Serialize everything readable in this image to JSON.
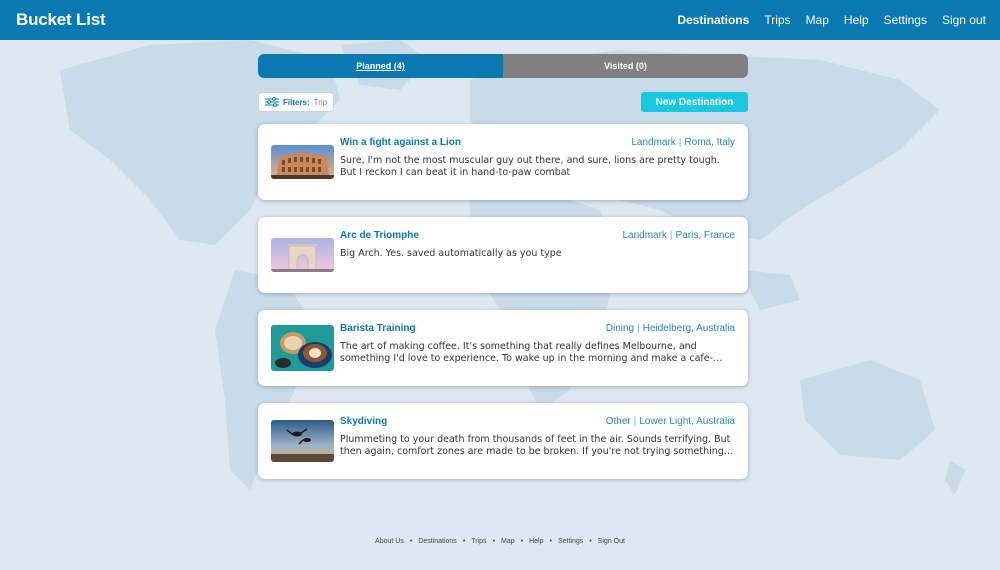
{
  "app": {
    "title": "Bucket List"
  },
  "nav": {
    "items": [
      {
        "label": "Destinations",
        "active": true
      },
      {
        "label": "Trips"
      },
      {
        "label": "Map"
      },
      {
        "label": "Help"
      },
      {
        "label": "Settings"
      },
      {
        "label": "Sign out"
      }
    ]
  },
  "tabs": [
    {
      "label": "Planned (4)",
      "active": true
    },
    {
      "label": "Visited (0)",
      "active": false
    }
  ],
  "toolbar": {
    "filters_label": "Filters:",
    "filters_value": "Trip",
    "new_destination_label": "New Destination"
  },
  "destinations": [
    {
      "title": "Win a fight against a Lion",
      "category": "Landmark",
      "location": "Roma, Italy",
      "description": "Sure, I'm not the most muscular guy out there, and sure, lions are pretty tough. But I reckon I can beat it in hand-to-paw combat",
      "thumbnail": "colosseum-photo"
    },
    {
      "title": "Arc de Triomphe",
      "category": "Landmark",
      "location": "Paris, France",
      "description": "Big Arch. Yes. saved automatically as you type",
      "thumbnail": "arc-de-triomphe-photo"
    },
    {
      "title": "Barista Training",
      "category": "Dining",
      "location": "Heidelberg, Australia",
      "description": "The art of making coffee. It's something that really defines Melbourne, and something I'd love to experience. To wake up in the morning and make a cafe-…",
      "thumbnail": "coffee-photo"
    },
    {
      "title": "Skydiving",
      "category": "Other",
      "location": "Lower Light, Australia",
      "description": "Plummeting to your death from thousands of feet in the air. Sounds terrifying. But then again, comfort zones are made to be broken. If you're not trying something…",
      "thumbnail": "skydiving-photo"
    }
  ],
  "footer": {
    "links": [
      "About Us",
      "Destinations",
      "Trips",
      "Map",
      "Help",
      "Settings",
      "Sign Out"
    ]
  },
  "colors": {
    "primary": "#0a79b2",
    "accent": "#17c8e0",
    "inactive_tab": "#808080",
    "background": "#dfe9f2"
  }
}
